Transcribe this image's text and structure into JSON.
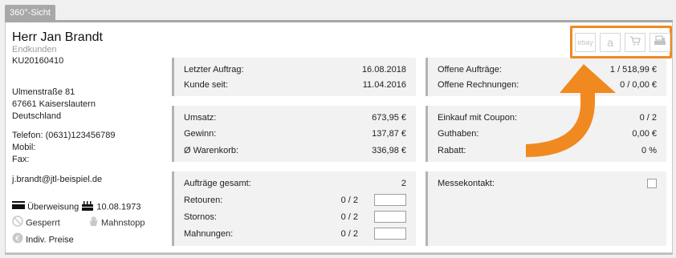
{
  "tab": {
    "label": "360°-Sicht"
  },
  "customer": {
    "name": "Herr Jan Brandt",
    "group": "Endkunden",
    "number": "KU20160410",
    "street": "Ulmenstraße 81",
    "city": "67661 Kaiserslautern",
    "country": "Deutschland",
    "phone": "Telefon: (0631)123456789",
    "mobile": "Mobil:",
    "fax": "Fax:",
    "email": "j.brandt@jtl-beispiel.de"
  },
  "details": {
    "payment": "Überweisung",
    "birthday": "10.08.1973",
    "blocked": "Gesperrt",
    "dunning_stop": "Mahnstopp",
    "individual_prices": "Indiv. Preise"
  },
  "orders_box": {
    "last_order_label": "Letzter Auftrag:",
    "last_order_value": "16.08.2018",
    "customer_since_label": "Kunde seit:",
    "customer_since_value": "11.04.2016"
  },
  "open_box": {
    "open_orders_label": "Offene Aufträge:",
    "open_orders_value": "1 / 518,99 €",
    "open_invoices_label": "Offene Rechnungen:",
    "open_invoices_value": "0 / 0,00 €"
  },
  "sales_box": {
    "revenue_label": "Umsatz:",
    "revenue_value": "673,95 €",
    "profit_label": "Gewinn:",
    "profit_value": "137,87 €",
    "basket_label": "Ø Warenkorb:",
    "basket_value": "336,98 €"
  },
  "coupon_box": {
    "coupon_label": "Einkauf mit Coupon:",
    "coupon_value": "0 / 2",
    "credit_label": "Guthaben:",
    "credit_value": "0,00 €",
    "discount_label": "Rabatt:",
    "discount_value": "0 %"
  },
  "totals_box": {
    "orders_total_label": "Aufträge gesamt:",
    "orders_total_value": "2",
    "returns_label": "Retouren:",
    "returns_value": "0 / 2",
    "cancellations_label": "Stornos:",
    "cancellations_value": "0 / 2",
    "reminders_label": "Mahnungen:",
    "reminders_value": "0 / 2"
  },
  "fair_box": {
    "fair_contact_label": "Messekontakt:",
    "fair_contact_checked": false
  },
  "marketplaces": {
    "ebay_label": "ebay",
    "amazon_label": "a",
    "icons": [
      "ebay-icon",
      "amazon-icon",
      "shop-cart-icon",
      "pos-register-icon"
    ],
    "highlight_color": "#f0891f"
  }
}
